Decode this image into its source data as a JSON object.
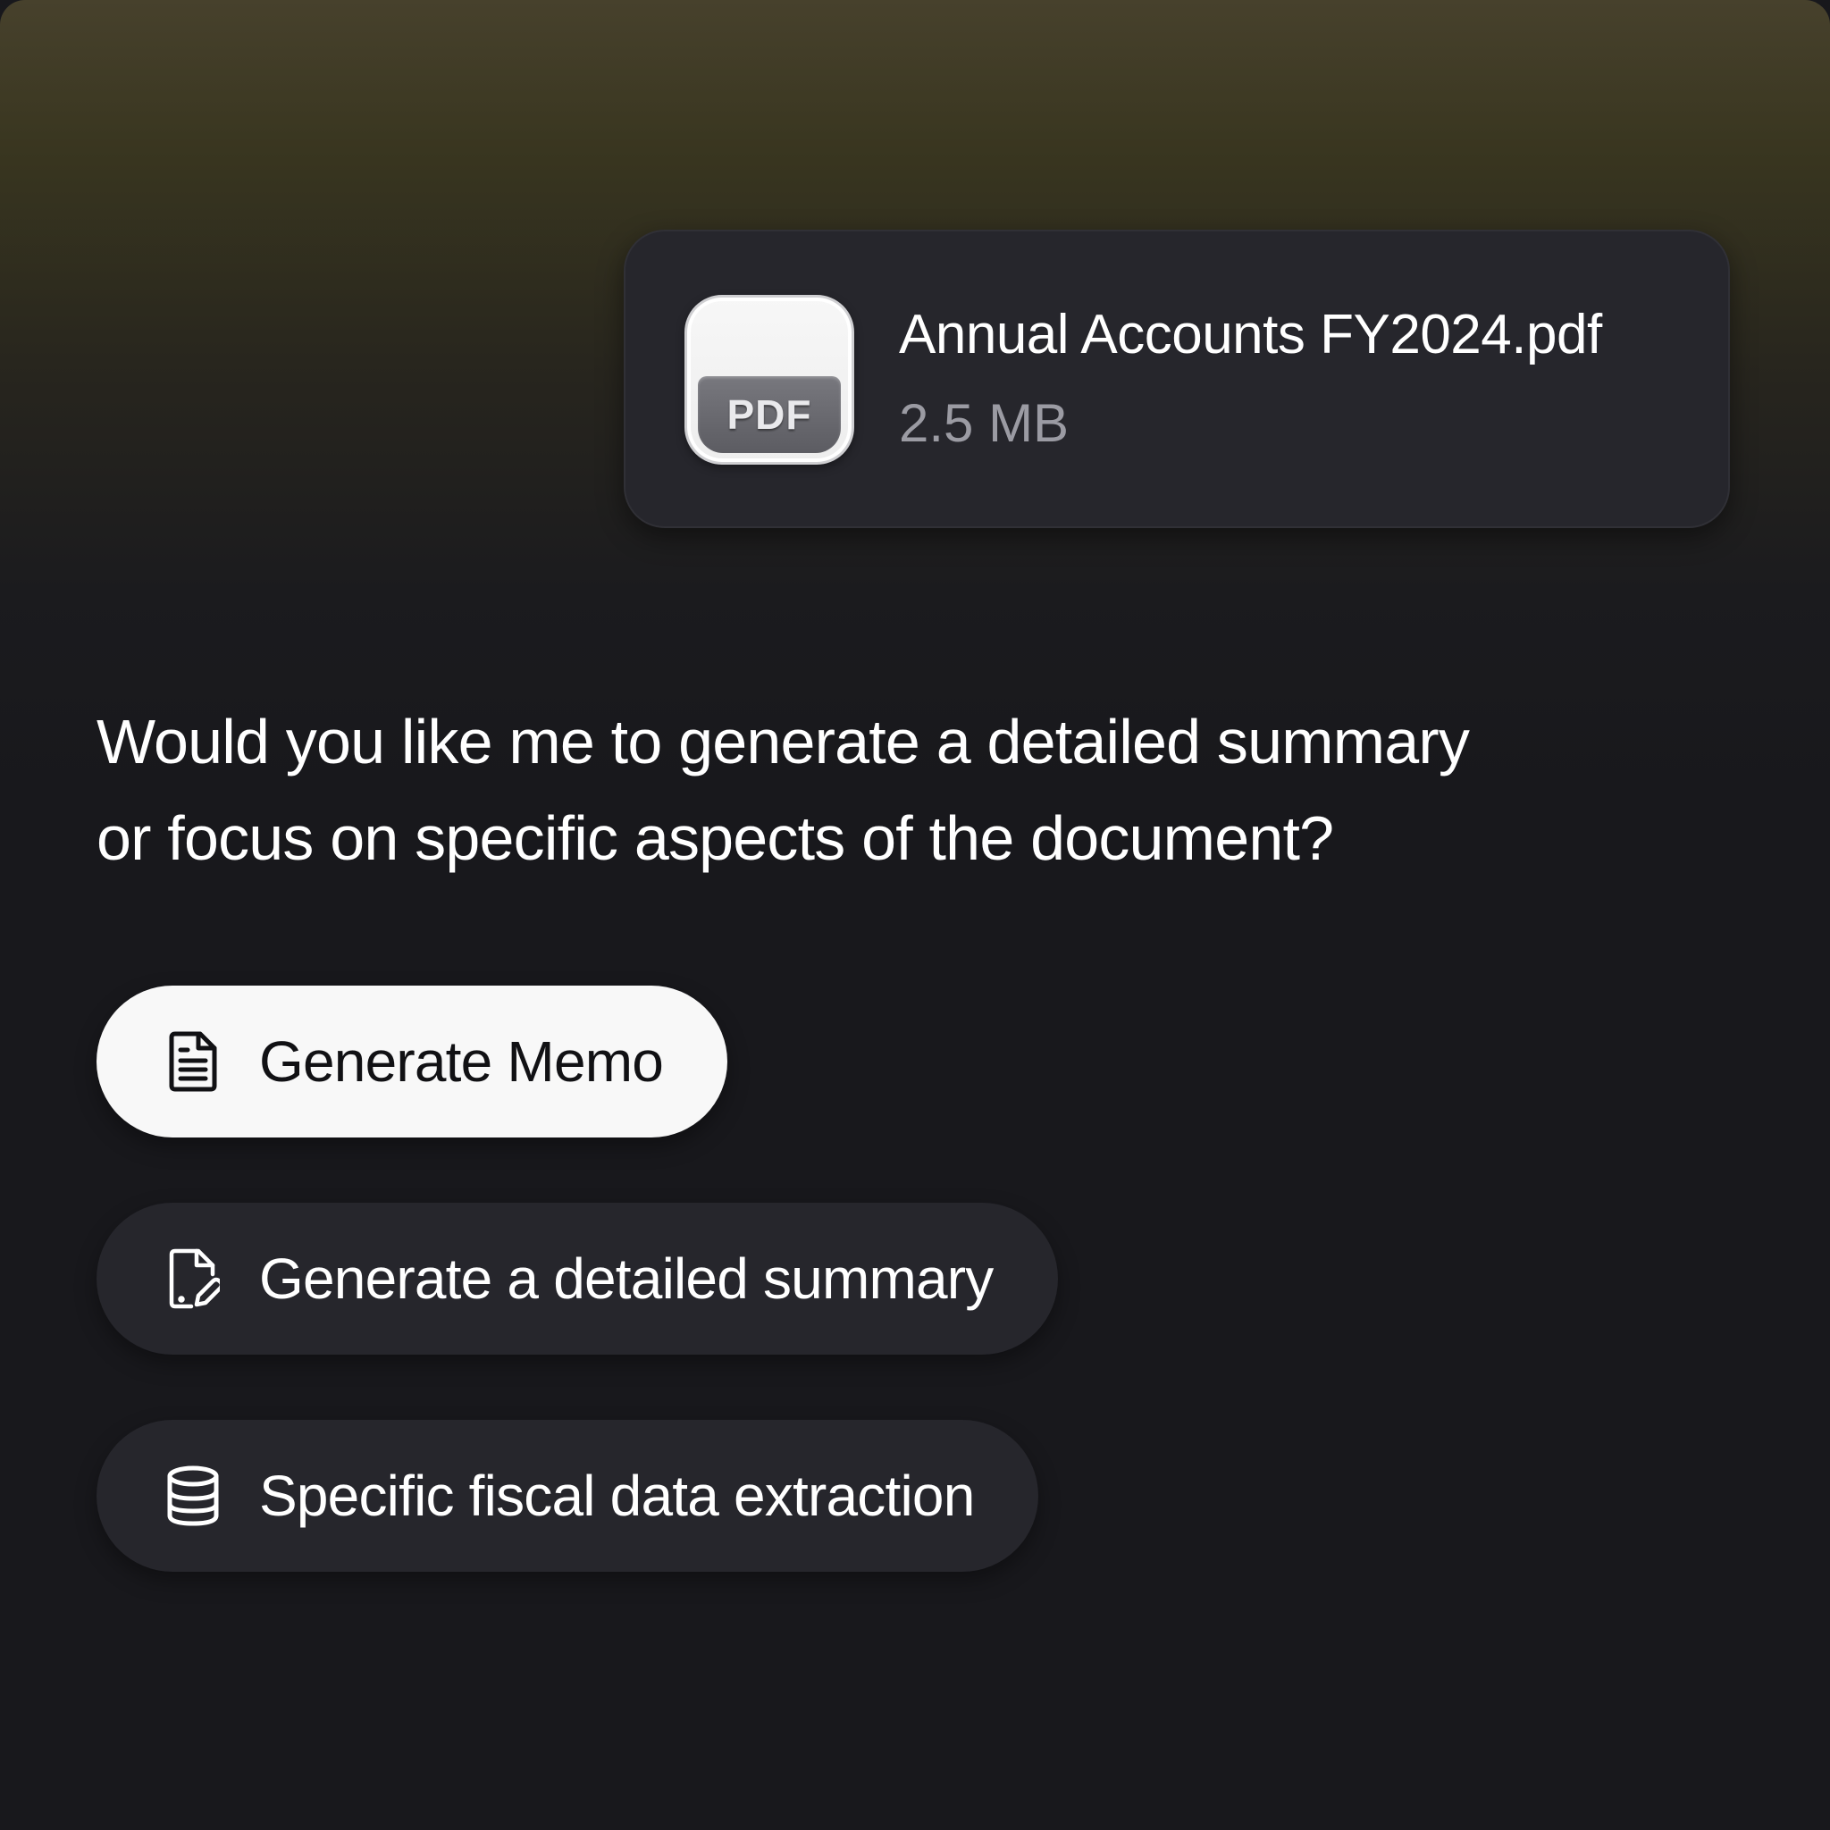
{
  "attachment": {
    "icon": "pdf-file-icon",
    "icon_label": "PDF",
    "file_name": "Annual Accounts FY2024.pdf",
    "file_size": "2.5 MB"
  },
  "message": {
    "line1": "Would you like me to generate a detailed summary",
    "line2": "or focus on specific aspects of the document?"
  },
  "actions": [
    {
      "icon": "document-text-icon",
      "label": "Generate Memo",
      "style": "primary"
    },
    {
      "icon": "document-edit-icon",
      "label": "Generate a detailed summary",
      "style": "secondary"
    },
    {
      "icon": "database-icon",
      "label": "Specific fiscal data extraction",
      "style": "secondary"
    }
  ],
  "colors": {
    "background": "#18181c",
    "card": "#26262c",
    "primary_button": "#f8f8f8",
    "muted_text": "#9b9ba3"
  }
}
